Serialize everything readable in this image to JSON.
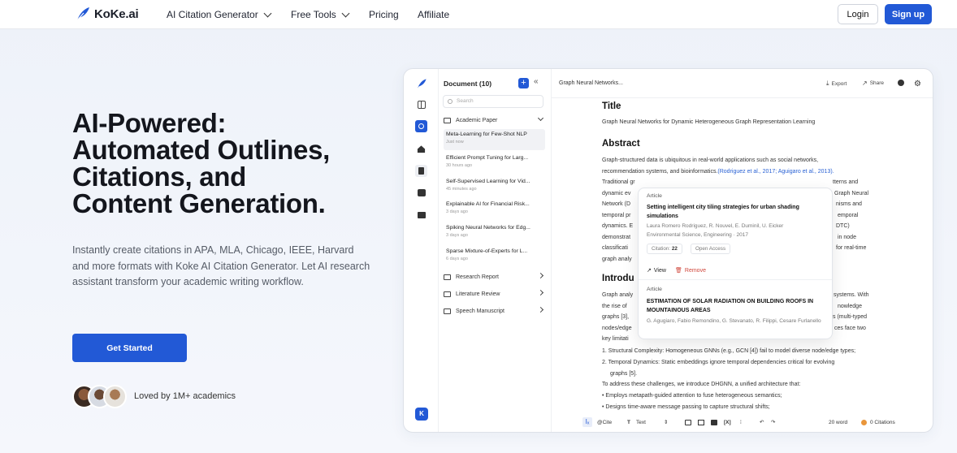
{
  "nav": {
    "logo": "KoKe.ai",
    "items": [
      "AI Citation Generator",
      "Free Tools",
      "Pricing",
      "Affiliate"
    ],
    "login": "Login",
    "signup": "Sign up"
  },
  "hero": {
    "title_lines": [
      "AI-Powered:",
      "Automated Outlines,",
      "Citations, and",
      "Content Generation."
    ],
    "description": "Instantly create citations in APA, MLA, Chicago, IEEE, Harvard and more formats with Koke AI Citation Generator. Let AI research assistant transform your academic writing workflow.",
    "cta": "Get Started",
    "social_proof": "Loved by 1M+ academics"
  },
  "app": {
    "doclist": {
      "header": "Document (10)",
      "search_placeholder": "Search",
      "folders": [
        "Academic Paper",
        "Research Report",
        "Literature Review",
        "Speech Manuscript"
      ],
      "docs": [
        {
          "title": "Meta-Learning for Few-Shot NLP",
          "time": "Just now"
        },
        {
          "title": "Efficient Prompt Tuning for Larg...",
          "time": "30 hours ago"
        },
        {
          "title": "Self-Supervised Learning for Vid...",
          "time": "45 minutes ago"
        },
        {
          "title": "Explainable AI for Financial Risk...",
          "time": "3 days ago"
        },
        {
          "title": "Spiking Neural Networks for Edg...",
          "time": "3 days ago"
        },
        {
          "title": "Sparse Mixture-of-Experts for L...",
          "time": "6 days ago"
        }
      ],
      "badge": "K"
    },
    "editor": {
      "breadcrumb": "Graph Neural Networks...",
      "export": "Export",
      "share": "Share",
      "title_heading": "Title",
      "title_text": "Graph Neural Networks for Dynamic Heterogeneous Graph Representation Learning",
      "abstract_heading": "Abstract",
      "abstract_l1": "Graph-structured data is ubiquitous in real-world applications such as social networks,",
      "abstract_l2a": "recommendation systems, and bioinformatics.",
      "abstract_l2b": "(Rodriguez et al., 2017; Aguigaro et al., 2013).",
      "abstract_l3": "Traditional gr",
      "abstract_l3r": "tterns and",
      "abstract_l4": "dynamic ev",
      "abstract_l4r": "Graph Neural",
      "abstract_l5": "Network (D",
      "abstract_l5r": "nisms and",
      "abstract_l6": "temporal pr",
      "abstract_l6r": "emporal",
      "abstract_l7": "dynamics. E",
      "abstract_l7r": "DTC)",
      "abstract_l8": "demonstrat",
      "abstract_l8r": "in node",
      "abstract_l9": "classificati",
      "abstract_l9r": "for real-time",
      "abstract_l10": "graph analy",
      "intro_heading": "Introdu",
      "intro_l1": "Graph analy",
      "intro_l1r": "systems. With",
      "intro_l2": "the rise of",
      "intro_l2r": "nowledge",
      "intro_l3": "graphs [3],",
      "intro_l3r": "s (multi-typed",
      "intro_l4": "nodes/edge",
      "intro_l4r": "ces face two",
      "intro_l5": "key limitati",
      "list1": "1. Structural Complexity: Homogeneous GNNs (e.g., GCN [4]) fail to model diverse node/edge types;",
      "list2a": "2. Temporal Dynamics: Static embeddings ignore temporal dependencies critical for evolving",
      "list2b": "graphs [5].",
      "address": "To address these challenges, we introduce DHGNN, a unified architecture that:",
      "bullet1": "• Employs metapath-guided attention to fuse heterogeneous semantics;",
      "bullet2": "• Designs time-aware message passing to capture structural shifts;",
      "bottom": {
        "cite": "@Cite",
        "text": "Text",
        "words": "20 word",
        "citations": "0 Citations"
      }
    },
    "popover": {
      "a1_label": "Article",
      "a1_title": "Setting intelligent city tiling strategies for urban shading simulations",
      "a1_authors": "Laura Romero Rodriguez, R. Nouvel, E. Duminil, U. Eicker",
      "a1_venue": "Environmental Science, Engineering · 2017",
      "citation_label": "Citation:",
      "citation_count": "22",
      "open_access": "Open Access",
      "view": "View",
      "remove": "Remove",
      "a2_label": "Article",
      "a2_title": "ESTIMATION OF SOLAR RADIATION ON BUILDING ROOFS IN MOUNTAINOUS AREAS",
      "a2_authors": "G. Agugiaro, Fabio Remondino, G. Stevanato, R. Filippi, Cesare Furlanello"
    }
  },
  "colors": {
    "accent": "#2259d6",
    "link": "#2a62d4",
    "remove": "#d0463b",
    "citation_dot": "#e9963b"
  }
}
